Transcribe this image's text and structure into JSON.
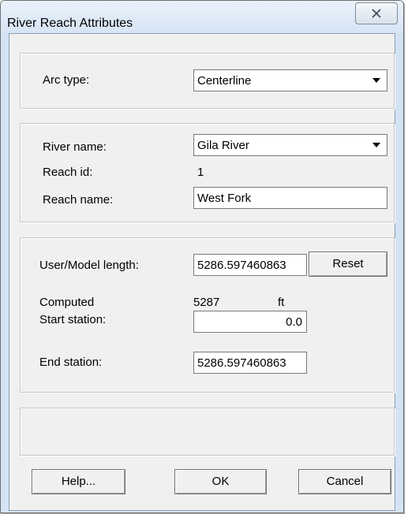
{
  "window": {
    "title": "River Reach Attributes",
    "close_label": "✕"
  },
  "arc": {
    "label": "Arc type:",
    "value": "Centerline"
  },
  "river": {
    "name_label": "River name:",
    "name_value": "Gila River",
    "reach_id_label": "Reach id:",
    "reach_id_value": "1",
    "reach_name_label": "Reach name:",
    "reach_name_value": "West Fork"
  },
  "length": {
    "user_label": "User/Model length:",
    "user_value": "5286.597460863",
    "reset_label": "Reset",
    "computed_label": "Computed",
    "computed_value": "5287",
    "computed_unit": "ft",
    "start_label": "Start station:",
    "start_value": "0.0",
    "end_label": "End station:",
    "end_value": "5286.597460863"
  },
  "buttons": {
    "help": "Help...",
    "ok": "OK",
    "cancel": "Cancel"
  }
}
